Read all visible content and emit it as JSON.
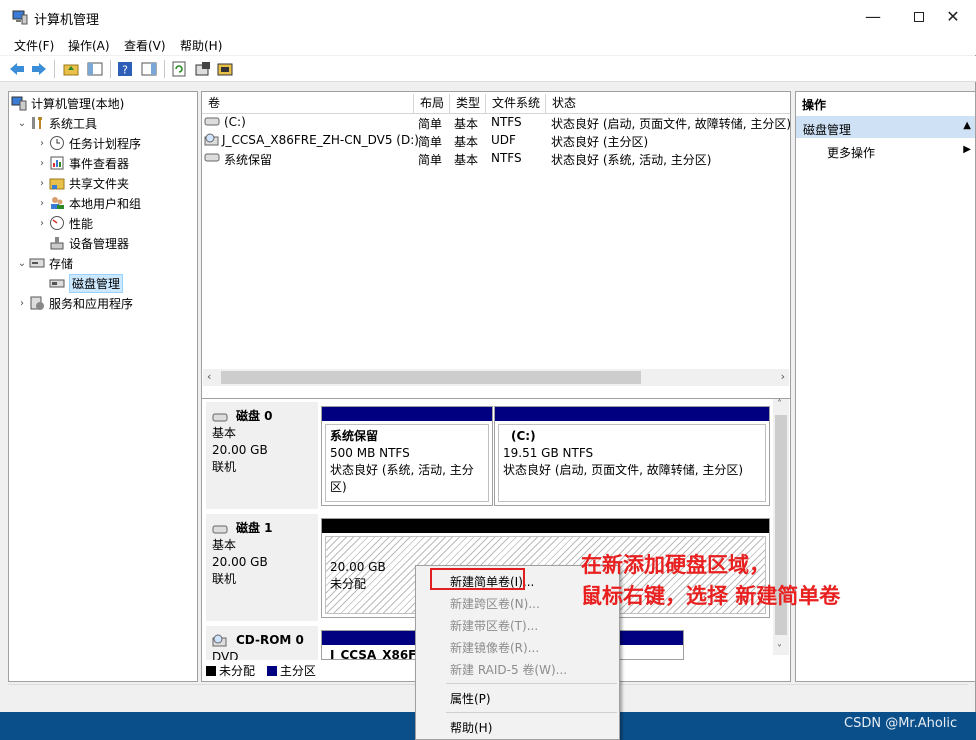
{
  "window": {
    "title": "计算机管理"
  },
  "menu": [
    "文件(F)",
    "操作(A)",
    "查看(V)",
    "帮助(H)"
  ],
  "tree": {
    "root": "计算机管理(本地)",
    "system_tools": "系统工具",
    "task_scheduler": "任务计划程序",
    "event_viewer": "事件查看器",
    "shared_folders": "共享文件夹",
    "local_users": "本地用户和组",
    "performance": "性能",
    "device_manager": "设备管理器",
    "storage": "存储",
    "disk_management": "磁盘管理",
    "services_apps": "服务和应用程序"
  },
  "volume_table": {
    "headers": [
      "卷",
      "布局",
      "类型",
      "文件系统",
      "状态"
    ],
    "rows": [
      {
        "name": "(C:)",
        "layout": "简单",
        "type": "基本",
        "fs": "NTFS",
        "status": "状态良好 (启动, 页面文件, 故障转储, 主分区)"
      },
      {
        "name": "J_CCSA_X86FRE_ZH-CN_DV5 (D:)",
        "layout": "简单",
        "type": "基本",
        "fs": "UDF",
        "status": "状态良好 (主分区)"
      },
      {
        "name": "系统保留",
        "layout": "简单",
        "type": "基本",
        "fs": "NTFS",
        "status": "状态良好 (系统, 活动, 主分区)"
      }
    ]
  },
  "disks": {
    "disk0": {
      "name": "磁盘 0",
      "type": "基本",
      "size": "20.00 GB",
      "state": "联机",
      "p1": {
        "name": "系统保留",
        "size": "500 MB NTFS",
        "status": "状态良好 (系统, 活动, 主分区)"
      },
      "p2": {
        "name": "(C:)",
        "size": "19.51 GB NTFS",
        "status": "状态良好 (启动, 页面文件, 故障转储, 主分区)"
      }
    },
    "disk1": {
      "name": "磁盘 1",
      "type": "基本",
      "size": "20.00 GB",
      "state": "联机",
      "p1": {
        "size": "20.00 GB",
        "status": "未分配"
      }
    },
    "cdrom": {
      "name": "CD-ROM 0",
      "type": "DVD",
      "partition": "J_CCSA_X86FRE"
    }
  },
  "legend": {
    "unallocated": "未分配",
    "primary": "主分区"
  },
  "actions": {
    "title": "操作",
    "section": "磁盘管理",
    "more": "更多操作"
  },
  "context_menu": {
    "new_simple": "新建简单卷(I)...",
    "new_spanned": "新建跨区卷(N)...",
    "new_striped": "新建带区卷(T)...",
    "new_mirrored": "新建镜像卷(R)...",
    "new_raid5": "新建 RAID-5 卷(W)...",
    "properties": "属性(P)",
    "help": "帮助(H)"
  },
  "annotation": {
    "line1": "在新添加硬盘区域，",
    "line2": "鼠标右键，选择 新建简单卷"
  },
  "watermark": "CSDN @Mr.Aholic",
  "colors": {
    "primary": "#000080",
    "unallocated": "#000000",
    "selection": "#cce8ff",
    "annotation": "#e82020"
  }
}
